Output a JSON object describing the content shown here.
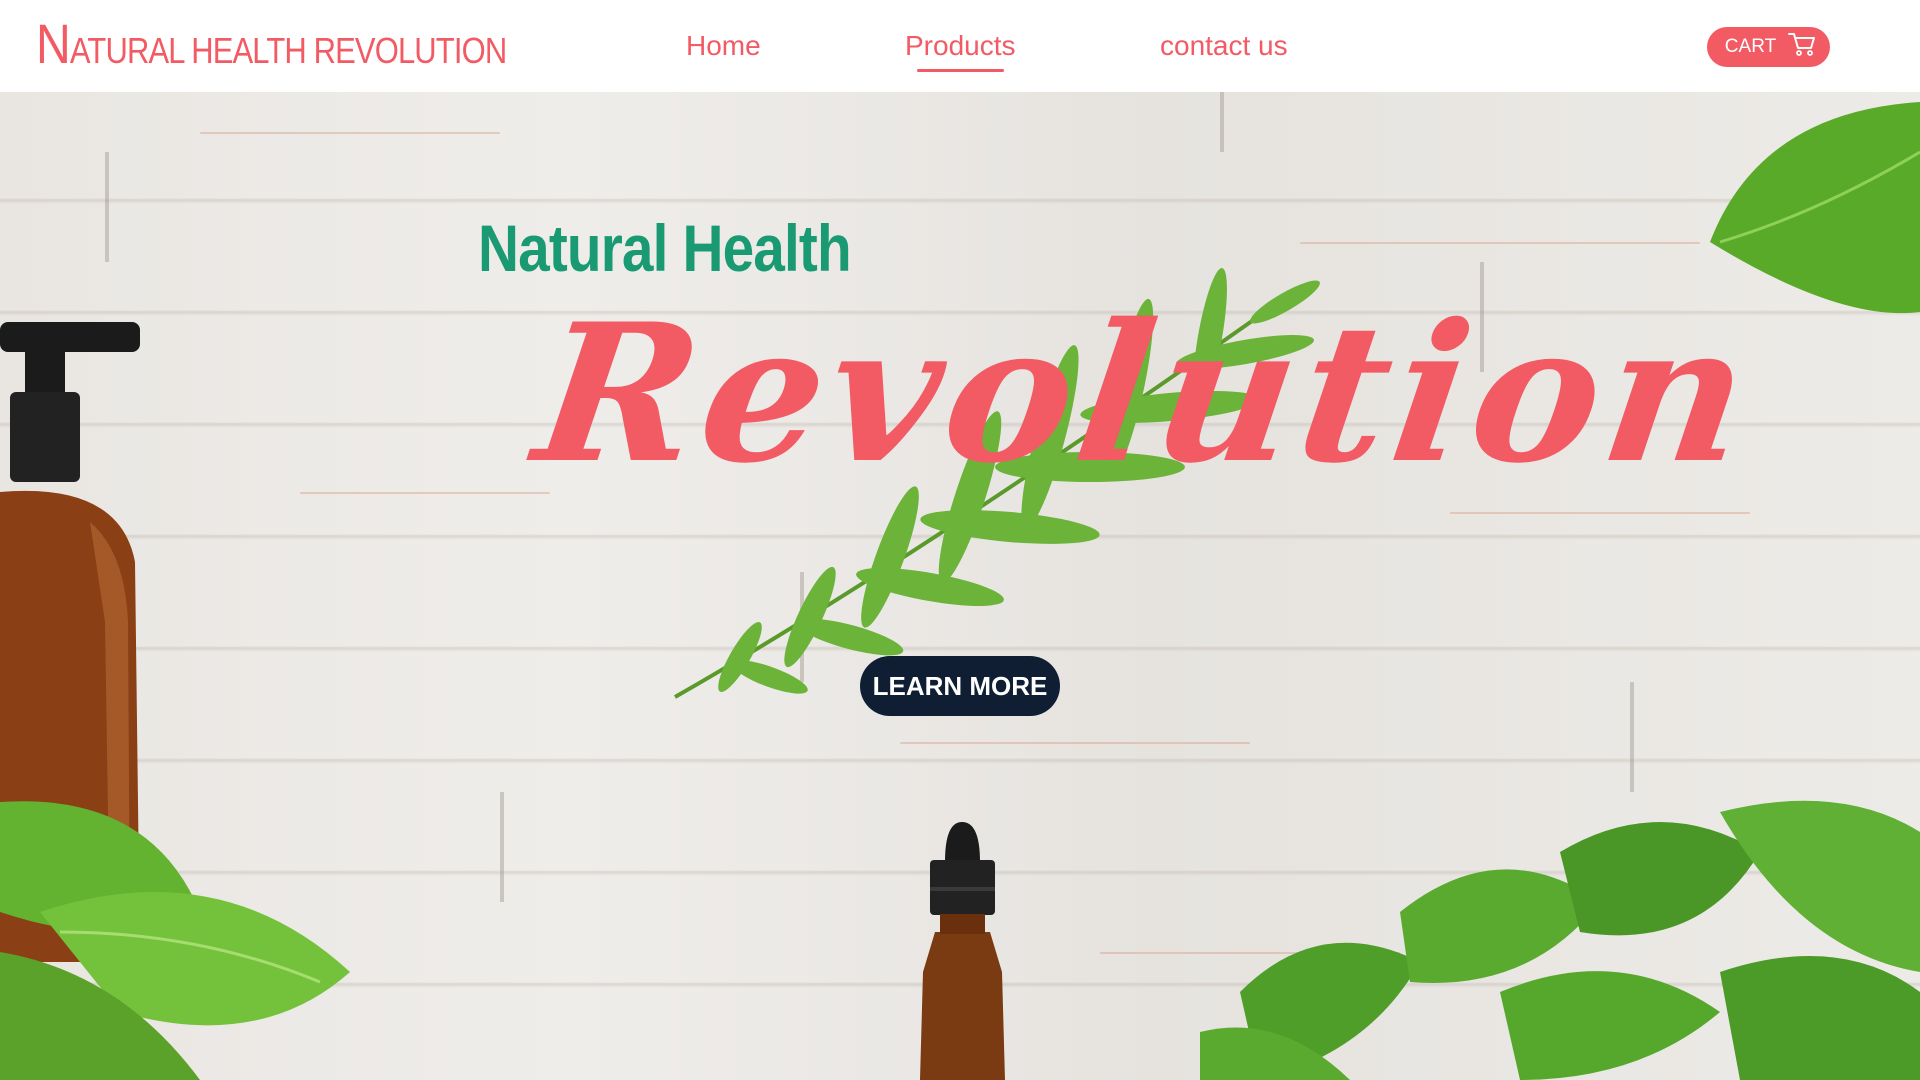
{
  "header": {
    "logo_initial": "N",
    "logo_rest": "ATURAL HEALTH REVOLUTION",
    "nav": [
      {
        "label": "Home"
      },
      {
        "label": "Products"
      },
      {
        "label": "contact us"
      }
    ],
    "active_nav": "Products",
    "cart_label": "CART"
  },
  "hero": {
    "title_small": "Natural Health",
    "title_big": "Revolution",
    "cta_label": "LEARN MORE"
  },
  "icons": {
    "cart": "cart-icon",
    "fern": "fern-leaf-icon",
    "pump_bottle": "pump-bottle-icon",
    "dropper_bottle": "dropper-bottle-icon",
    "plant_leaves": "leaves-icon"
  },
  "colors": {
    "brand_coral": "#f25a64",
    "brand_green": "#1a9a72",
    "cta_navy": "#0f1e33"
  }
}
